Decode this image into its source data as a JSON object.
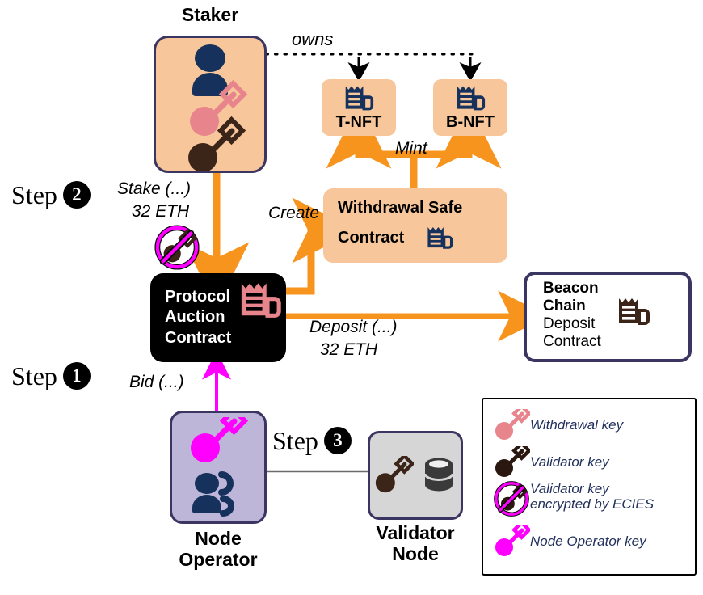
{
  "diagram": {
    "title_nodes": {
      "staker": "Staker",
      "node_operator_line1": "Node",
      "node_operator_line2": "Operator",
      "validator_node_line1": "Validator",
      "validator_node_line2": "Node"
    },
    "boxes": {
      "t_nft": "T-NFT",
      "b_nft": "B-NFT",
      "withdrawal_safe_line1": "Withdrawal Safe",
      "withdrawal_safe_line2": "Contract",
      "protocol_auction_line1": "Protocol",
      "protocol_auction_line2": "Auction",
      "protocol_auction_line3": "Contract",
      "beacon_line1": "Beacon",
      "beacon_line2": "Chain",
      "beacon_line3": "Deposit",
      "beacon_line4": "Contract"
    },
    "edge_labels": {
      "owns": "owns",
      "mint": "Mint",
      "create": "Create",
      "stake_line1": "Stake (...)",
      "stake_line2": "32 ETH",
      "deposit_line1": "Deposit (...)",
      "deposit_line2": "32 ETH",
      "bid": "Bid (...)"
    },
    "steps": [
      {
        "word": "Step",
        "number": "1"
      },
      {
        "word": "Step",
        "number": "2"
      },
      {
        "word": "Step",
        "number": "3"
      }
    ],
    "legend": {
      "items": [
        {
          "icon": "withdrawal-key-icon",
          "label": "Withdrawal key",
          "label2": ""
        },
        {
          "icon": "validator-key-icon",
          "label": "Validator key",
          "label2": ""
        },
        {
          "icon": "encrypted-validator-key-icon",
          "label": "Validator key",
          "label2": "encrypted by ECIES"
        },
        {
          "icon": "node-operator-key-icon",
          "label": "Node Operator key",
          "label2": ""
        }
      ]
    },
    "colors": {
      "peach": "#f7c79b",
      "navy": "#15315c",
      "border_navy": "#3b3561",
      "orange": "#f7941e",
      "magenta": "#ff00ff",
      "pink_key": "#e8848c",
      "dark_key": "#3b2418",
      "purple_fill": "#bdb6d8",
      "gray_fill": "#d6d6d6",
      "black": "#000000",
      "white": "#ffffff"
    }
  }
}
